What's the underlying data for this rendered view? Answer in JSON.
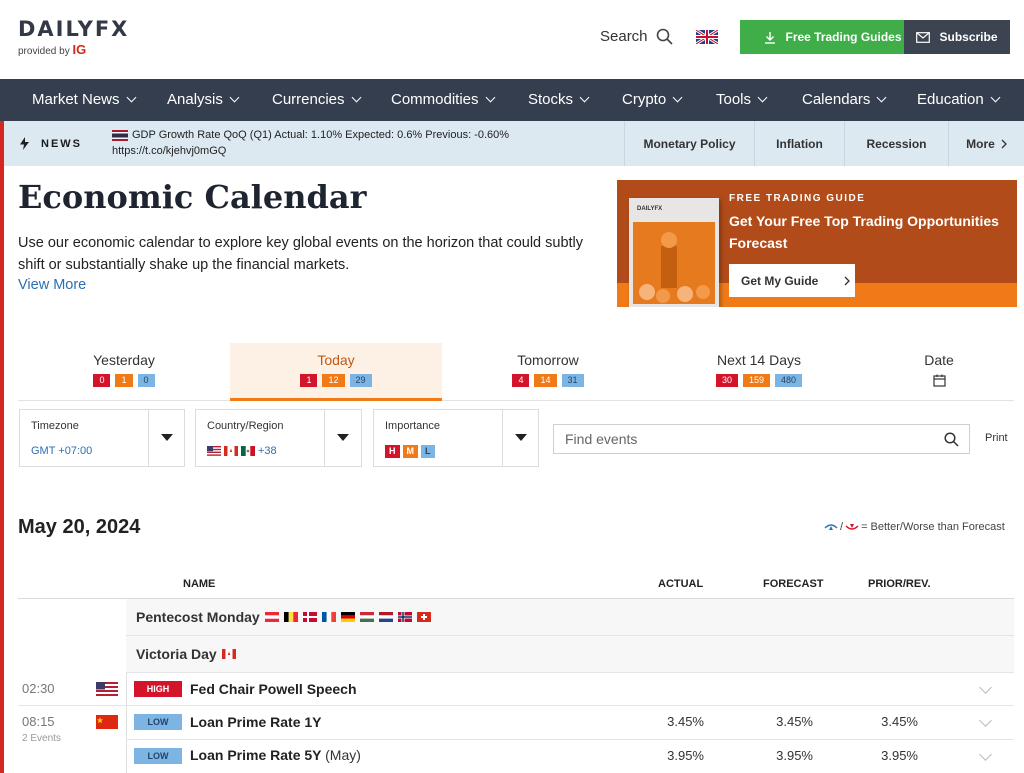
{
  "header": {
    "logo_text": "DAILYFX",
    "logo_sub": "provided by",
    "logo_brand": "IG",
    "search_label": "Search",
    "free_guides_label": "Free Trading Guides",
    "subscribe_label": "Subscribe"
  },
  "nav": {
    "items": [
      "Market News",
      "Analysis",
      "Currencies",
      "Commodities",
      "Stocks",
      "Crypto",
      "Tools",
      "Calendars",
      "Education"
    ]
  },
  "newsbar": {
    "label": "NEWS",
    "headline_line1": "GDP Growth Rate QoQ (Q1) Actual: 1.10% Expected: 0.6% Previous: -0.60%",
    "headline_line2": "https://t.co/kjehvj0mGQ",
    "tabs": [
      "Monetary Policy",
      "Inflation",
      "Recession",
      "More"
    ]
  },
  "page": {
    "title": "Economic Calendar",
    "description": "Use our economic calendar to explore key global events on the horizon that could subtly shift or substantially shake up the financial markets.",
    "view_more": "View More"
  },
  "promo": {
    "pre_title": "FREE TRADING GUIDE",
    "headline": "Get Your Free Top Trading Opportunities Forecast",
    "button": "Get My Guide",
    "book_logo": "DAILYFX"
  },
  "day_tabs": [
    {
      "label": "Yesterday",
      "high": "0",
      "medium": "1",
      "low": "0"
    },
    {
      "label": "Today",
      "high": "1",
      "medium": "12",
      "low": "29"
    },
    {
      "label": "Tomorrow",
      "high": "4",
      "medium": "14",
      "low": "31"
    },
    {
      "label": "Next 14 Days",
      "high": "30",
      "medium": "159",
      "low": "480"
    },
    {
      "label": "Date"
    }
  ],
  "filters": {
    "timezone_label": "Timezone",
    "timezone_value": "GMT +07:00",
    "country_label": "Country/Region",
    "country_extra": "+38",
    "importance_label": "Importance",
    "importance_h": "H",
    "importance_m": "M",
    "importance_l": "L",
    "find_placeholder": "Find events",
    "print_label": "Print"
  },
  "calendar": {
    "date": "May 20, 2024",
    "legend": "= Better/Worse than Forecast",
    "col_name": "NAME",
    "col_actual": "ACTUAL",
    "col_forecast": "FORECAST",
    "col_prior": "PRIOR/REV.",
    "holidays": [
      "Pentecost Monday",
      "Victoria Day"
    ],
    "events": [
      {
        "time": "02:30",
        "sub": "",
        "importance": "HIGH",
        "name": "Fed Chair Powell Speech",
        "period": "",
        "actual": "",
        "forecast": "",
        "prior": ""
      },
      {
        "time": "08:15",
        "sub": "2 Events",
        "importance": "LOW",
        "name": "Loan Prime Rate 1Y",
        "period": "",
        "actual": "3.45%",
        "forecast": "3.45%",
        "prior": "3.45%"
      },
      {
        "time": "",
        "sub": "",
        "importance": "LOW",
        "name": "Loan Prime Rate 5Y",
        "period": "(May)",
        "actual": "3.95%",
        "forecast": "3.95%",
        "prior": "3.95%"
      }
    ]
  },
  "colors": {
    "nav_bg": "#353e4e",
    "green_btn": "#3fae49",
    "accent_orange": "#f07a17",
    "high_red": "#d4142a",
    "low_blue": "#7cb5e3",
    "link_blue": "#2b6fb5"
  }
}
